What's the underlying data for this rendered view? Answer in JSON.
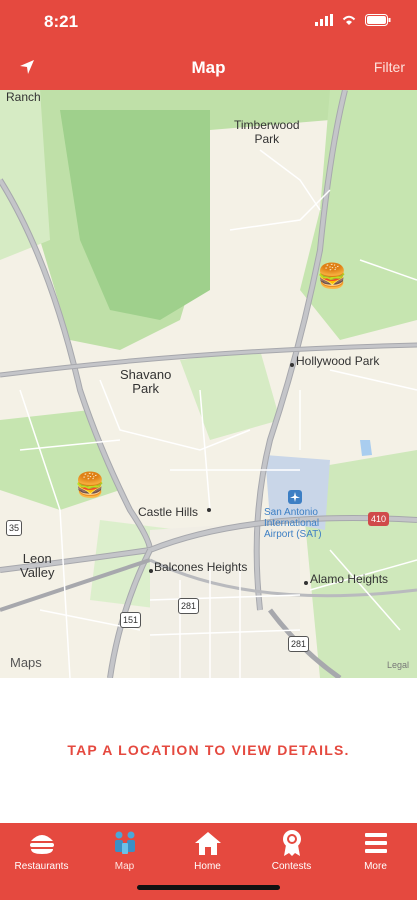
{
  "status_bar": {
    "time": "8:21"
  },
  "header": {
    "title": "Map",
    "filter_label": "Filter"
  },
  "map": {
    "places": {
      "ranch": "Ranch",
      "timberwood": "Timberwood\nPark",
      "shavano": "Shavano\nPark",
      "hollywood": "Hollywood Park",
      "castle_hills": "Castle Hills",
      "airport": "San Antonio\nInternational\nAirport (SAT)",
      "leon_valley": "Leon\nValley",
      "balcones": "Balcones Heights",
      "alamo": "Alamo Heights"
    },
    "highway_shields": [
      "35",
      "410",
      "151",
      "281"
    ],
    "attribution": "Maps",
    "legal": "Legal",
    "marker_icon": "burger-icon"
  },
  "instruction": "TAP A LOCATION TO VIEW DETAILS.",
  "tabs": [
    {
      "label": "Restaurants",
      "icon": "burger-icon",
      "active": false
    },
    {
      "label": "Map",
      "icon": "map-people-icon",
      "active": true
    },
    {
      "label": "Home",
      "icon": "home-icon",
      "active": false
    },
    {
      "label": "Contests",
      "icon": "award-icon",
      "active": false
    },
    {
      "label": "More",
      "icon": "menu-icon",
      "active": false
    }
  ],
  "colors": {
    "brand": "#e5493f",
    "map_green": "#bfe0a8",
    "map_dark_green": "#8cc884"
  }
}
